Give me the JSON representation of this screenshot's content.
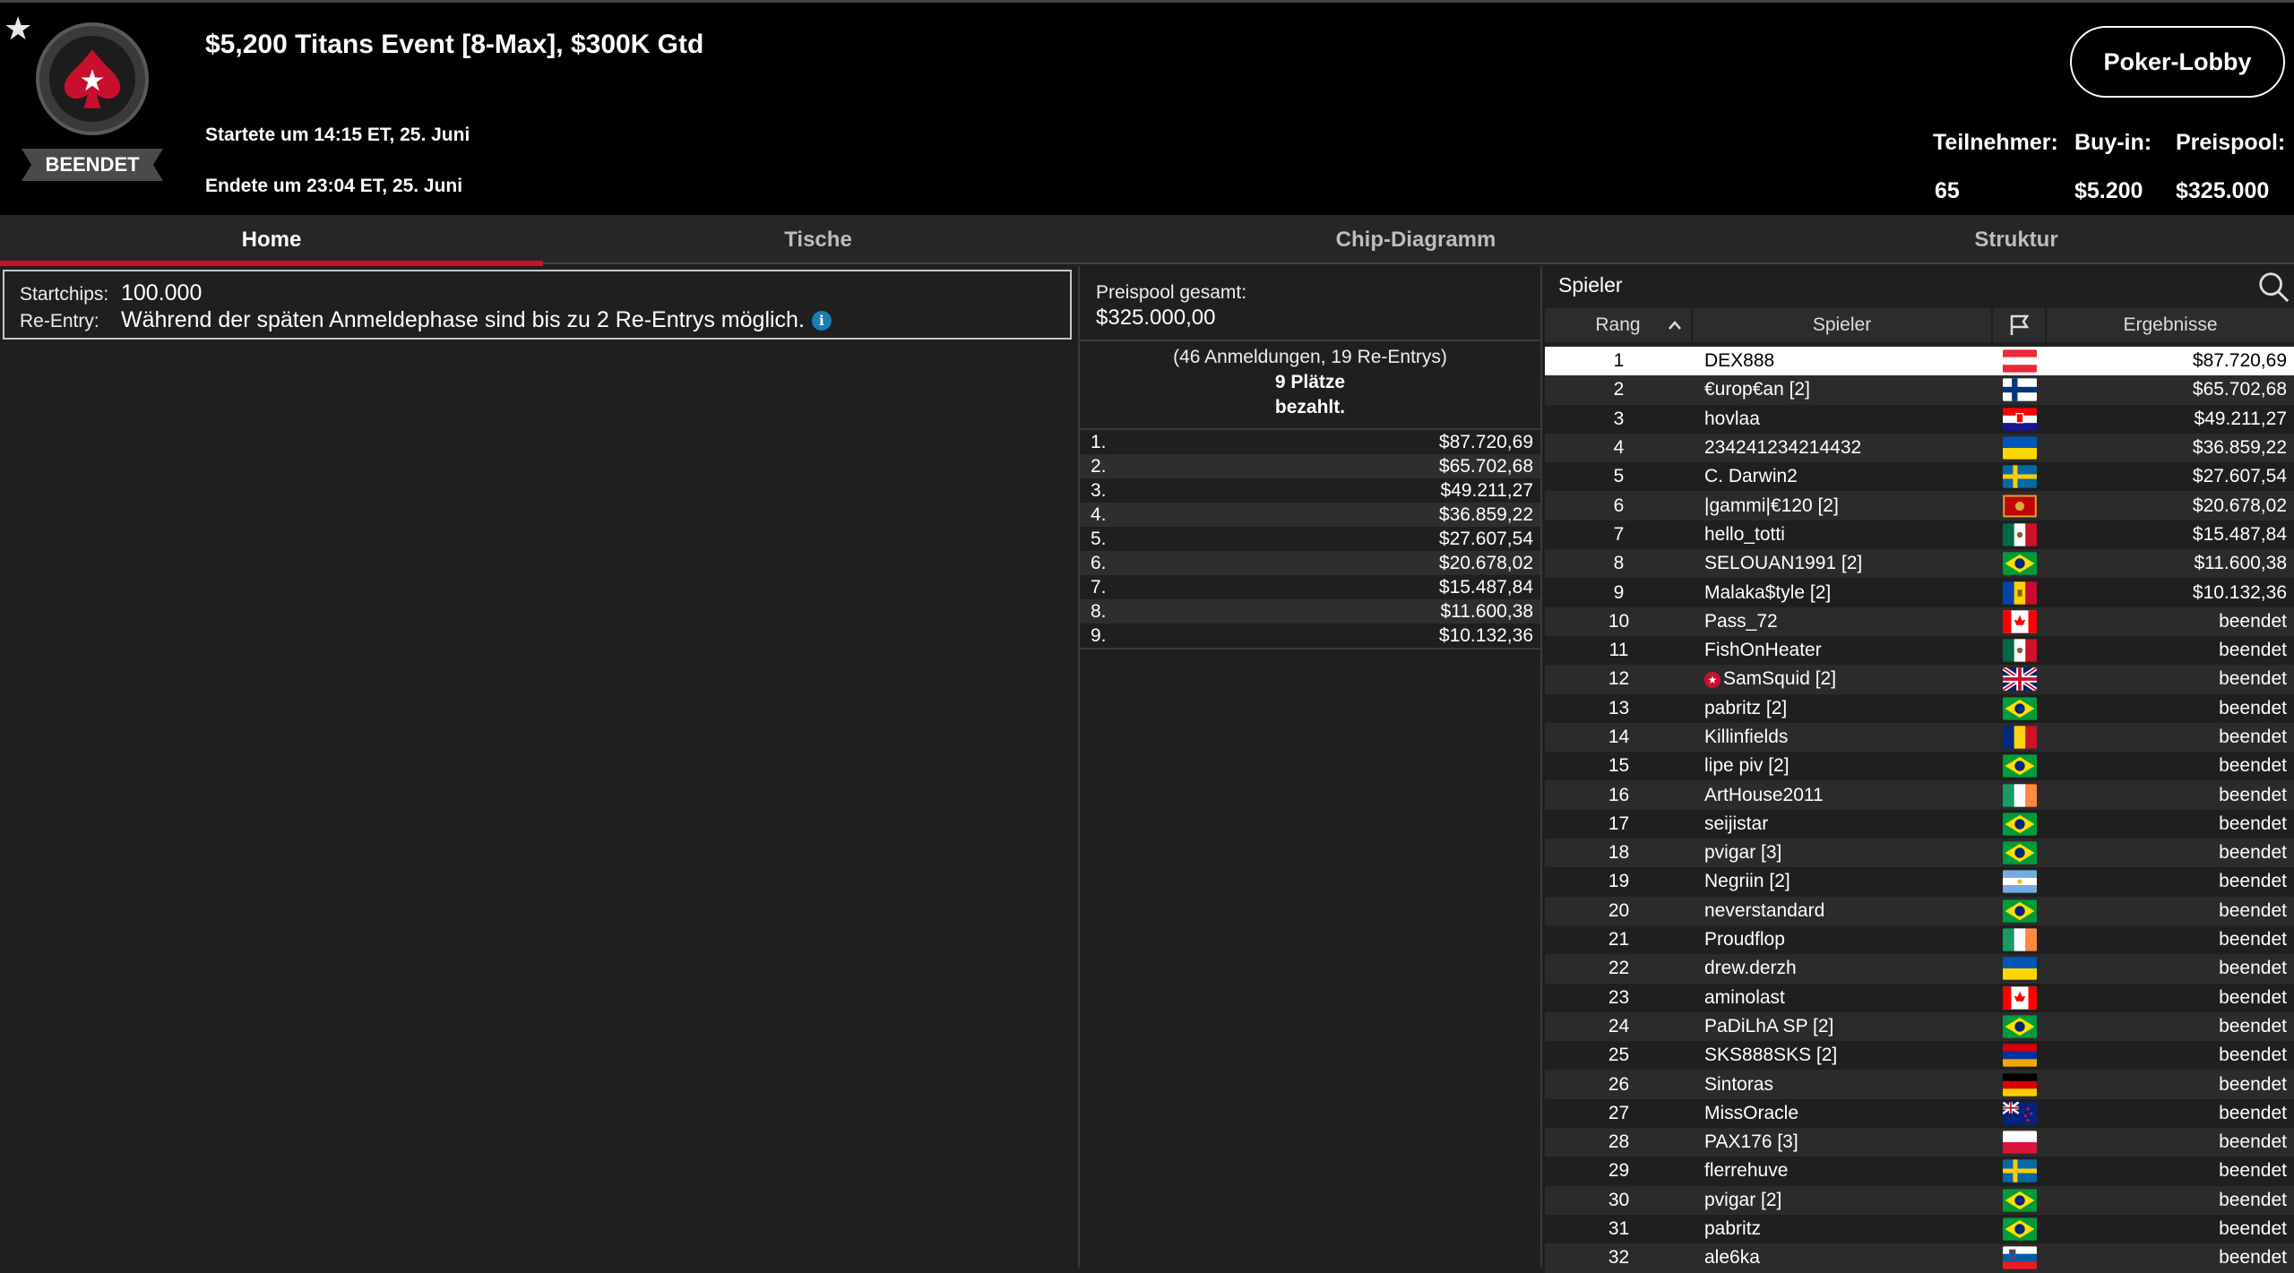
{
  "header": {
    "favorite_icon": "star-icon",
    "logo_icon": "pokerstars-spade-logo",
    "status": "BEENDET",
    "title": "$5,200 Titans Event [8-Max], $300K Gtd",
    "started": "Startete um 14:15 ET, 25. Juni",
    "ended": "Endete um 23:04 ET, 25. Juni",
    "lobby_button": "Poker-Lobby",
    "stats": [
      {
        "label": "Teilnehmer:",
        "value": "65"
      },
      {
        "label": "Buy-in:",
        "value": "$5.200"
      },
      {
        "label": "Preispool:",
        "value": "$325.000"
      }
    ]
  },
  "tabs": [
    {
      "label": "Home",
      "active": true
    },
    {
      "label": "Tische",
      "active": false
    },
    {
      "label": "Chip-Diagramm",
      "active": false
    },
    {
      "label": "Struktur",
      "active": false
    }
  ],
  "info": {
    "startchips_label": "Startchips:",
    "startchips_value": "100.000",
    "reentry_label": "Re-Entry:",
    "reentry_value": "Während der späten Anmeldephase sind bis zu 2 Re-Entrys möglich.",
    "info_icon": "info-icon"
  },
  "prize": {
    "pool_label": "Preispool gesamt:",
    "pool_value": "$325.000,00",
    "entries": "(46 Anmeldungen, 19 Re-Entrys)",
    "places": "9 Plätze",
    "paid": "bezahlt.",
    "payouts": [
      {
        "place": "1.",
        "amount": "$87.720,69"
      },
      {
        "place": "2.",
        "amount": "$65.702,68"
      },
      {
        "place": "3.",
        "amount": "$49.211,27"
      },
      {
        "place": "4.",
        "amount": "$36.859,22"
      },
      {
        "place": "5.",
        "amount": "$27.607,54"
      },
      {
        "place": "6.",
        "amount": "$20.678,02"
      },
      {
        "place": "7.",
        "amount": "$15.487,84"
      },
      {
        "place": "8.",
        "amount": "$11.600,38"
      },
      {
        "place": "9.",
        "amount": "$10.132,36"
      }
    ]
  },
  "players": {
    "search_label": "Spieler",
    "search_icon": "search-icon",
    "columns": {
      "rank": "Rang",
      "player": "Spieler",
      "flag_icon": "flag-icon",
      "result": "Ergebnisse",
      "sort_icon": "chevron-up-icon"
    },
    "rows": [
      {
        "rank": "1",
        "name": "DEX888",
        "country": "austria",
        "result": "$87.720,69",
        "selected": true
      },
      {
        "rank": "2",
        "name": "€urop€an [2]",
        "country": "finland",
        "result": "$65.702,68"
      },
      {
        "rank": "3",
        "name": "hovlaa",
        "country": "croatia",
        "result": "$49.211,27"
      },
      {
        "rank": "4",
        "name": "234241234214432",
        "country": "ukraine",
        "result": "$36.859,22"
      },
      {
        "rank": "5",
        "name": "C. Darwin2",
        "country": "sweden",
        "result": "$27.607,54"
      },
      {
        "rank": "6",
        "name": "|gammi|€120 [2]",
        "country": "montenegro",
        "result": "$20.678,02"
      },
      {
        "rank": "7",
        "name": "hello_totti",
        "country": "mexico",
        "result": "$15.487,84"
      },
      {
        "rank": "8",
        "name": "SELOUAN1991 [2]",
        "country": "brazil",
        "result": "$11.600,38"
      },
      {
        "rank": "9",
        "name": "Malaka$tyle [2]",
        "country": "moldova",
        "result": "$10.132,36"
      },
      {
        "rank": "10",
        "name": "Pass_72",
        "country": "canada",
        "result": "beendet"
      },
      {
        "rank": "11",
        "name": "FishOnHeater",
        "country": "mexico",
        "result": "beendet"
      },
      {
        "rank": "12",
        "name": "SamSquid [2]",
        "country": "uk",
        "result": "beendet",
        "pro": true
      },
      {
        "rank": "13",
        "name": "pabritz [2]",
        "country": "brazil",
        "result": "beendet"
      },
      {
        "rank": "14",
        "name": "Killinfields",
        "country": "romania",
        "result": "beendet"
      },
      {
        "rank": "15",
        "name": "lipe piv [2]",
        "country": "brazil",
        "result": "beendet"
      },
      {
        "rank": "16",
        "name": "ArtHouse2011",
        "country": "ireland",
        "result": "beendet"
      },
      {
        "rank": "17",
        "name": "seijistar",
        "country": "brazil",
        "result": "beendet"
      },
      {
        "rank": "18",
        "name": "pvigar [3]",
        "country": "brazil",
        "result": "beendet"
      },
      {
        "rank": "19",
        "name": "Negriin [2]",
        "country": "argentina",
        "result": "beendet"
      },
      {
        "rank": "20",
        "name": "neverstandard",
        "country": "brazil",
        "result": "beendet"
      },
      {
        "rank": "21",
        "name": "Proudflop",
        "country": "ireland",
        "result": "beendet"
      },
      {
        "rank": "22",
        "name": "drew.derzh",
        "country": "ukraine",
        "result": "beendet"
      },
      {
        "rank": "23",
        "name": "aminolast",
        "country": "canada",
        "result": "beendet"
      },
      {
        "rank": "24",
        "name": "PaDiLhA SP [2]",
        "country": "brazil",
        "result": "beendet"
      },
      {
        "rank": "25",
        "name": "SKS888SKS [2]",
        "country": "armenia",
        "result": "beendet"
      },
      {
        "rank": "26",
        "name": "Sintoras",
        "country": "germany",
        "result": "beendet"
      },
      {
        "rank": "27",
        "name": "MissOracle",
        "country": "new-zealand",
        "result": "beendet"
      },
      {
        "rank": "28",
        "name": "PAX176 [3]",
        "country": "poland",
        "result": "beendet"
      },
      {
        "rank": "29",
        "name": "flerrehuve",
        "country": "sweden",
        "result": "beendet"
      },
      {
        "rank": "30",
        "name": "pvigar [2]",
        "country": "brazil",
        "result": "beendet"
      },
      {
        "rank": "31",
        "name": "pabritz",
        "country": "brazil",
        "result": "beendet"
      },
      {
        "rank": "32",
        "name": "ale6ka",
        "country": "slovenia",
        "result": "beendet"
      }
    ]
  },
  "colors": {
    "accent": "#c8102e",
    "background": "#1f1f1f",
    "header": "#000000"
  }
}
